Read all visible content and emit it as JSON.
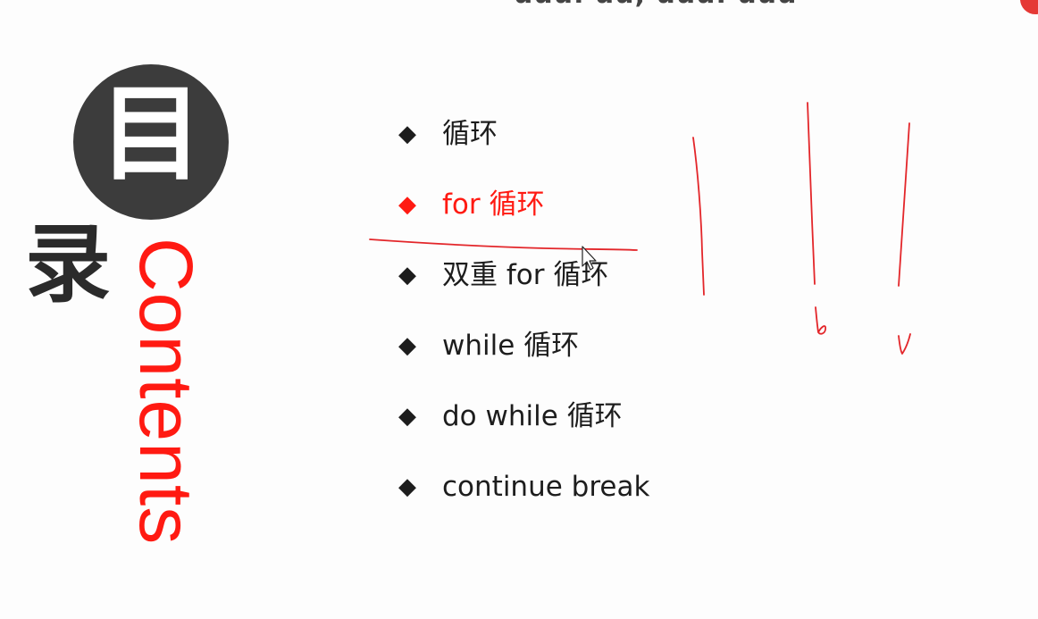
{
  "slide": {
    "top_heading": "uuu. uu, uuu. uuu",
    "title_char_1": "目",
    "title_char_2": "录",
    "contents_word": "Contents"
  },
  "toc": {
    "items": [
      {
        "label": "循环",
        "active": false
      },
      {
        "label": "for 循环",
        "active": true
      },
      {
        "label": "双重 for 循环",
        "active": false
      },
      {
        "label": "while 循环",
        "active": false
      },
      {
        "label": "do while 循环",
        "active": false
      },
      {
        "label": "continue break",
        "active": false
      }
    ],
    "bullet_icon": "diamond-bullet-icon"
  },
  "colors": {
    "accent_red": "#ff1a12",
    "circle_dark": "#3c3c3c",
    "text_dark": "#1d1d1d",
    "annotation_red": "#e3262a"
  },
  "annotations": {
    "letters": [
      "b",
      "v"
    ]
  }
}
